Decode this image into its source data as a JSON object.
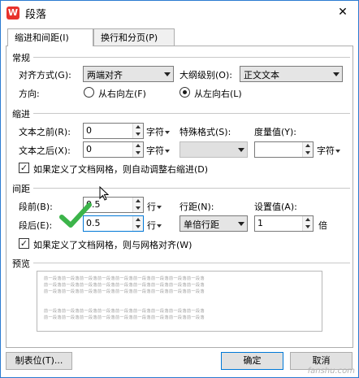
{
  "window": {
    "title": "段落",
    "app_icon_letter": "W",
    "close_glyph": "✕"
  },
  "tabs": [
    {
      "label": "缩进和间距(I)",
      "active": true
    },
    {
      "label": "换行和分页(P)",
      "active": false
    }
  ],
  "general": {
    "section_label": "常规",
    "alignment_label": "对齐方式(G):",
    "alignment_value": "两端对齐",
    "outline_label": "大纲级别(O):",
    "outline_value": "正文文本",
    "direction_label": "方向:",
    "direction_options": [
      "从右向左(F)",
      "从左向右(L)"
    ],
    "direction_selected": "从左向右(L)"
  },
  "indent": {
    "section_label": "缩进",
    "before_label": "文本之前(R):",
    "before_value": "0",
    "before_unit": "字符",
    "after_label": "文本之后(X):",
    "after_value": "0",
    "after_unit": "字符",
    "special_label": "特殊格式(S):",
    "special_value": "",
    "measure_label": "度量值(Y):",
    "measure_value": "",
    "measure_unit": "字符",
    "grid_checkbox_label": "如果定义了文档网格，则自动调整右缩进(D)",
    "grid_checked": true
  },
  "spacing": {
    "section_label": "间距",
    "before_label": "段前(B):",
    "before_value": "0.5",
    "before_unit": "行",
    "after_label": "段后(E):",
    "after_value": "0.5",
    "after_unit": "行",
    "line_spacing_label": "行距(N):",
    "line_spacing_value": "单倍行距",
    "setting_label": "设置值(A):",
    "setting_value": "1",
    "setting_unit": "倍",
    "grid_checkbox_label": "如果定义了文档网格，则与网格对齐(W)",
    "grid_checked": true
  },
  "preview": {
    "section_label": "预览",
    "sample_text": "前一段落前一段落前一段落前一段落前一段落前一段落前一段落前一段落前一段落"
  },
  "buttons": {
    "tabs_label": "制表位(T)...",
    "ok_label": "确定",
    "cancel_label": "取消"
  },
  "watermark": "fanshu.com",
  "colors": {
    "accent": "#0078d7",
    "window_border": "#2b7bd1",
    "checkmark": "#3cb44a"
  }
}
